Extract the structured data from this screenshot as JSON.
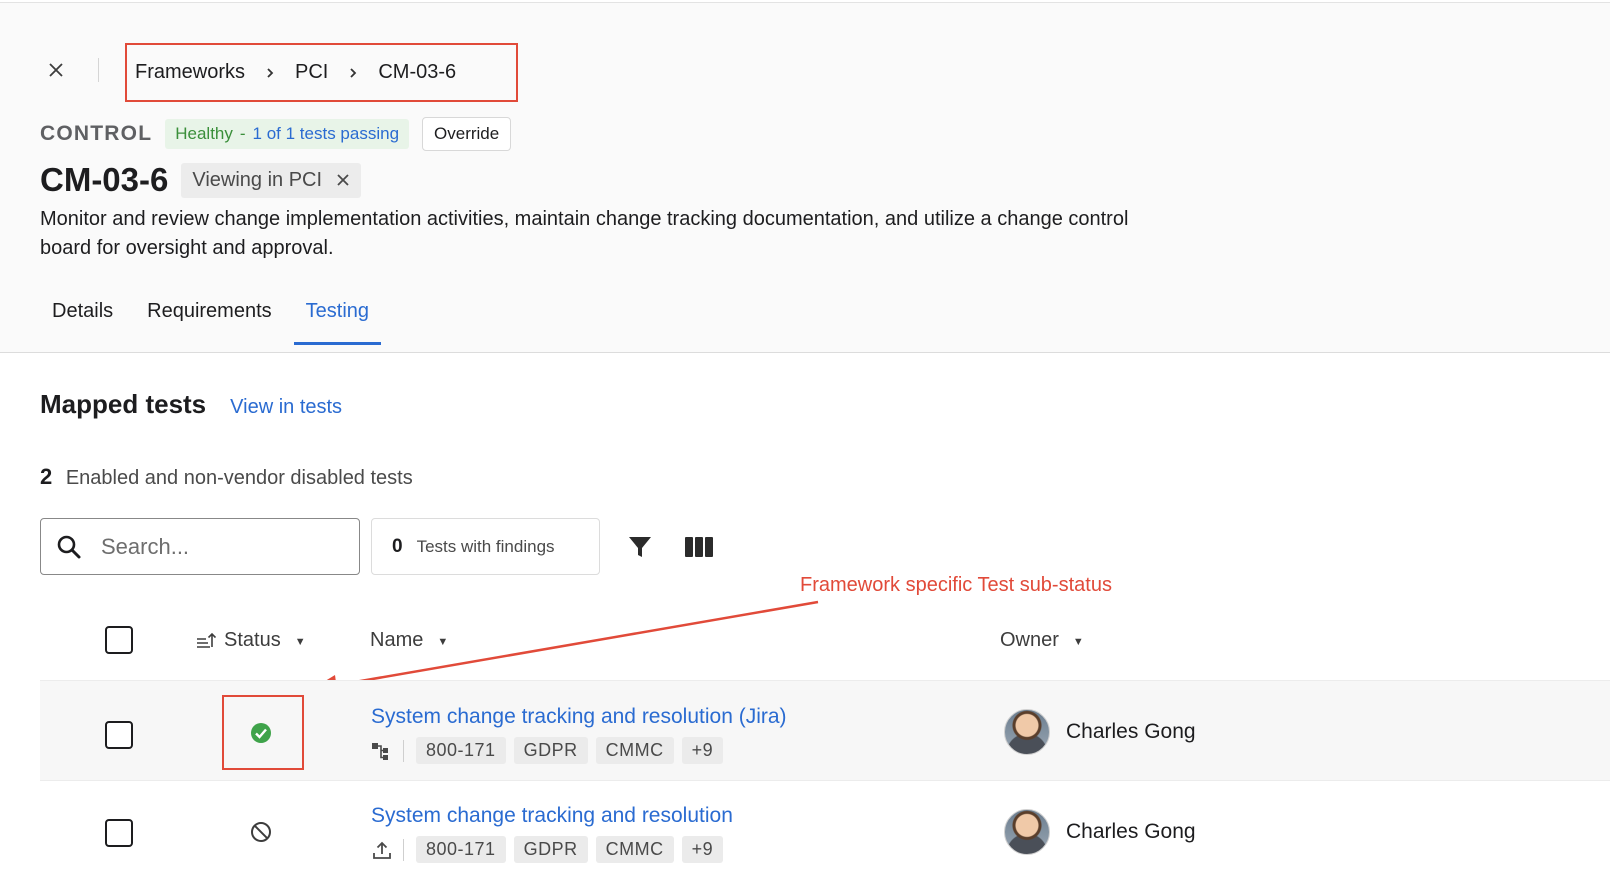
{
  "breadcrumb": {
    "items": [
      "Frameworks",
      "PCI",
      "CM-03-6"
    ]
  },
  "control": {
    "eyebrow": "CONTROL",
    "health_status": "Healthy",
    "health_separator": "-",
    "health_detail": "1 of 1 tests passing",
    "override_label": "Override",
    "title": "CM-03-6",
    "view_chip": "Viewing in PCI",
    "description": "Monitor and review change implementation activities, maintain change tracking documentation, and utilize a change control board for oversight and approval."
  },
  "tabs": [
    {
      "label": "Details",
      "active": false
    },
    {
      "label": "Requirements",
      "active": false
    },
    {
      "label": "Testing",
      "active": true
    }
  ],
  "mapped_tests": {
    "title": "Mapped tests",
    "view_link": "View in tests",
    "count": "2",
    "count_label": "Enabled and non-vendor disabled tests"
  },
  "toolbar": {
    "search_placeholder": "Search...",
    "findings_count": "0",
    "findings_label": "Tests with findings"
  },
  "annotation": {
    "text": "Framework specific Test sub-status",
    "color": "#e14a39"
  },
  "table": {
    "columns": [
      "Status",
      "Name",
      "Owner"
    ],
    "rows": [
      {
        "status": "passing",
        "name": "System change tracking and resolution (Jira)",
        "tag_icon": "integration-icon",
        "tags": [
          "800-171",
          "GDPR",
          "CMMC",
          "+9"
        ],
        "owner": "Charles Gong"
      },
      {
        "status": "not-applicable",
        "name": "System change tracking and resolution",
        "tag_icon": "upload-icon",
        "tags": [
          "800-171",
          "GDPR",
          "CMMC",
          "+9"
        ],
        "owner": "Charles Gong"
      }
    ]
  },
  "colors": {
    "accent": "#2a6bd1",
    "success": "#3a8f3a",
    "annotation": "#e14a39"
  }
}
